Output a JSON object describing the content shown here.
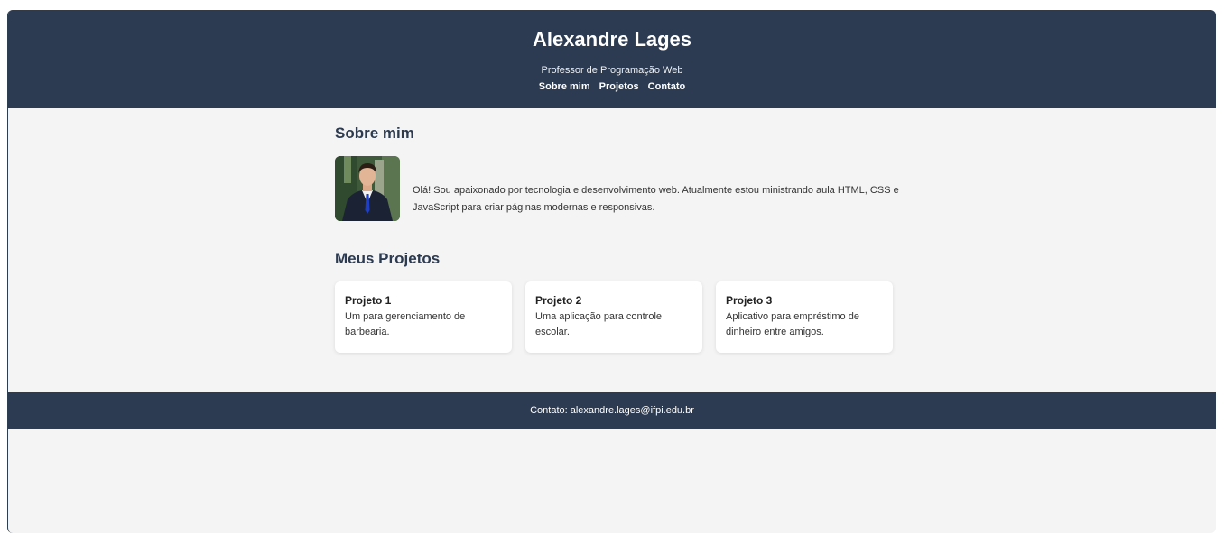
{
  "header": {
    "title": "Alexandre Lages",
    "subtitle": "Professor de Programação Web",
    "nav": [
      {
        "label": "Sobre mim"
      },
      {
        "label": "Projetos"
      },
      {
        "label": "Contato"
      }
    ]
  },
  "about": {
    "heading": "Sobre mim",
    "text": "Olá! Sou apaixonado por tecnologia e desenvolvimento web. Atualmente estou ministrando aula HTML, CSS e JavaScript para criar páginas modernas e responsivas."
  },
  "projects": {
    "heading": "Meus Projetos",
    "items": [
      {
        "title": "Projeto 1",
        "description": "Um para gerenciamento de barbearia."
      },
      {
        "title": "Projeto 2",
        "description": "Uma aplicação para controle escolar."
      },
      {
        "title": "Projeto 3",
        "description": "Aplicativo para empréstimo de dinheiro entre amigos."
      }
    ]
  },
  "footer": {
    "text": "Contato: alexandre.lages@ifpi.edu.br"
  },
  "colors": {
    "header_bg": "#2c3b51",
    "page_bg": "#f4f4f4",
    "card_bg": "#ffffff",
    "heading": "#2c3b51"
  }
}
